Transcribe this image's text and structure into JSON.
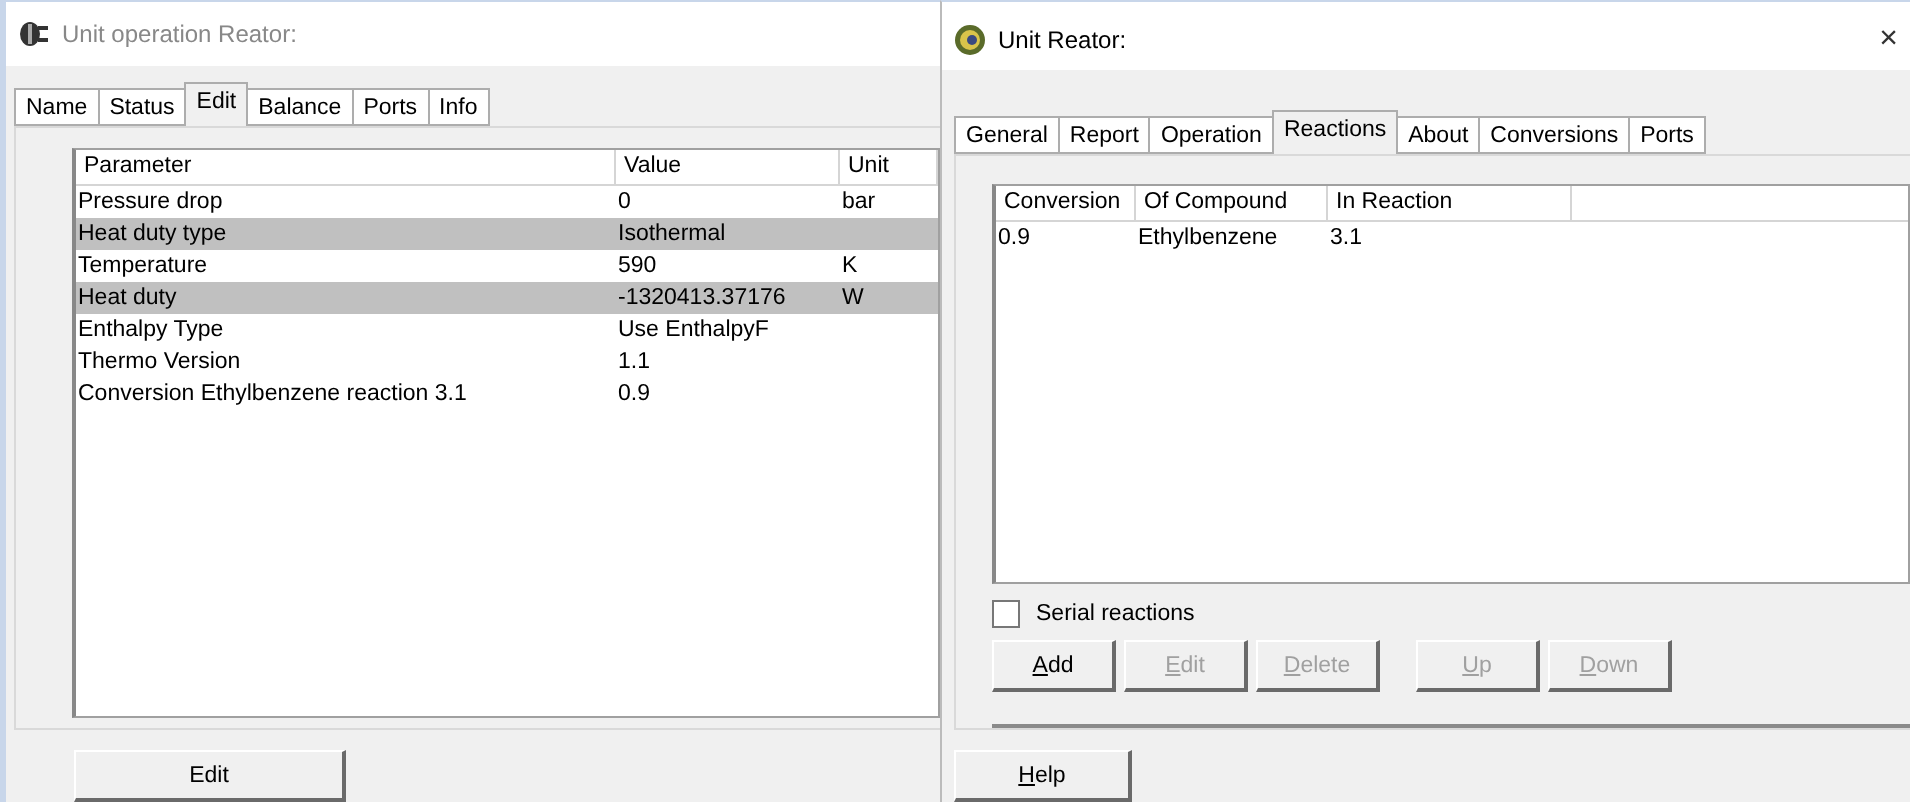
{
  "windows": [
    {
      "title": "Unit operation Reator:",
      "active": false,
      "tabs": [
        {
          "label": "Name",
          "selected": false
        },
        {
          "label": "Status",
          "selected": false
        },
        {
          "label": "Edit",
          "selected": true
        },
        {
          "label": "Balance",
          "selected": false
        },
        {
          "label": "Ports",
          "selected": false
        },
        {
          "label": "Info",
          "selected": false
        }
      ],
      "table": {
        "columns": [
          "Parameter",
          "Value",
          "Unit"
        ],
        "rows": [
          {
            "cells": [
              "Pressure drop",
              "0",
              "bar"
            ],
            "highlighted": false
          },
          {
            "cells": [
              "Heat duty type",
              "Isothermal",
              ""
            ],
            "highlighted": true
          },
          {
            "cells": [
              "Temperature",
              "590",
              "K"
            ],
            "highlighted": false
          },
          {
            "cells": [
              "Heat duty",
              "-1320413.37176",
              "W"
            ],
            "highlighted": true
          },
          {
            "cells": [
              "Enthalpy Type",
              "Use EnthalpyF",
              ""
            ],
            "highlighted": false
          },
          {
            "cells": [
              "Thermo Version",
              "1.1",
              ""
            ],
            "highlighted": false
          },
          {
            "cells": [
              "Conversion Ethylbenzene reaction 3.1",
              "0.9",
              ""
            ],
            "highlighted": false
          }
        ]
      },
      "footer_button": {
        "label": "Edit"
      }
    },
    {
      "title": "Unit Reator:",
      "active": true,
      "close": "×",
      "tabs": [
        {
          "label": "General",
          "selected": false
        },
        {
          "label": "Report",
          "selected": false
        },
        {
          "label": "Operation",
          "selected": false
        },
        {
          "label": "Reactions",
          "selected": true
        },
        {
          "label": "About",
          "selected": false
        },
        {
          "label": "Conversions",
          "selected": false
        },
        {
          "label": "Ports",
          "selected": false
        }
      ],
      "table": {
        "columns": [
          "Conversion",
          "Of Compound",
          "In Reaction"
        ],
        "rows": [
          {
            "cells": [
              "0.9",
              "Ethylbenzene",
              "3.1"
            ],
            "highlighted": false
          }
        ]
      },
      "checkbox": {
        "label": "Serial reactions",
        "checked": false
      },
      "button_groups": [
        [
          {
            "label": "Add",
            "first_letter_underlined": true,
            "disabled": false
          },
          {
            "label": "Edit",
            "first_letter_underlined": true,
            "disabled": true
          },
          {
            "label": "Delete",
            "first_letter_underlined": true,
            "disabled": true
          }
        ],
        [
          {
            "label": "Up",
            "first_letter_underlined": true,
            "disabled": true
          },
          {
            "label": "Down",
            "first_letter_underlined": true,
            "disabled": true
          }
        ]
      ],
      "footer_button": {
        "label": "Help",
        "first_letter_underlined": true
      }
    }
  ]
}
